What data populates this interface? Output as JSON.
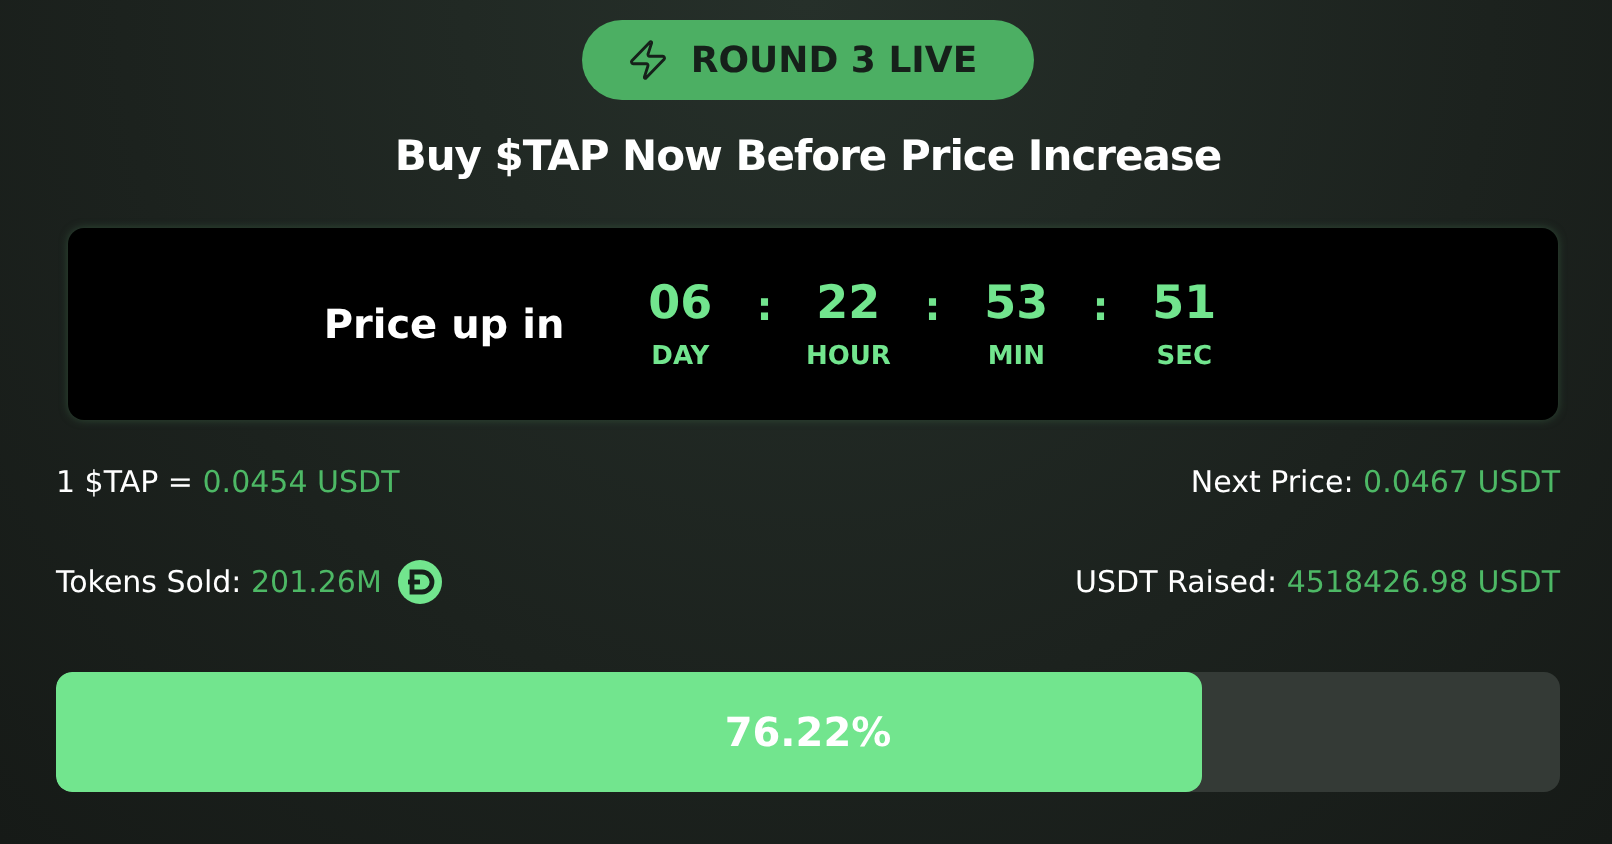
{
  "badge": {
    "label": "ROUND 3 LIVE"
  },
  "headline": "Buy $TAP Now Before Price Increase",
  "countdown": {
    "label": "Price up in",
    "separator": ":",
    "units": [
      {
        "value": "06",
        "unit": "DAY"
      },
      {
        "value": "22",
        "unit": "HOUR"
      },
      {
        "value": "53",
        "unit": "MIN"
      },
      {
        "value": "51",
        "unit": "SEC"
      }
    ]
  },
  "stats": [
    {
      "label": "1 $TAP = ",
      "value": "0.0454 USDT",
      "icon": false
    },
    {
      "label": "Next Price: ",
      "value": "0.0467 USDT",
      "icon": false
    },
    {
      "label": "Tokens Sold: ",
      "value": "201.26M",
      "icon": true
    },
    {
      "label": "USDT Raised: ",
      "value": "4518426.98 USDT",
      "icon": false
    }
  ],
  "progress": {
    "level": 0.7622,
    "reading": "76.22%"
  }
}
